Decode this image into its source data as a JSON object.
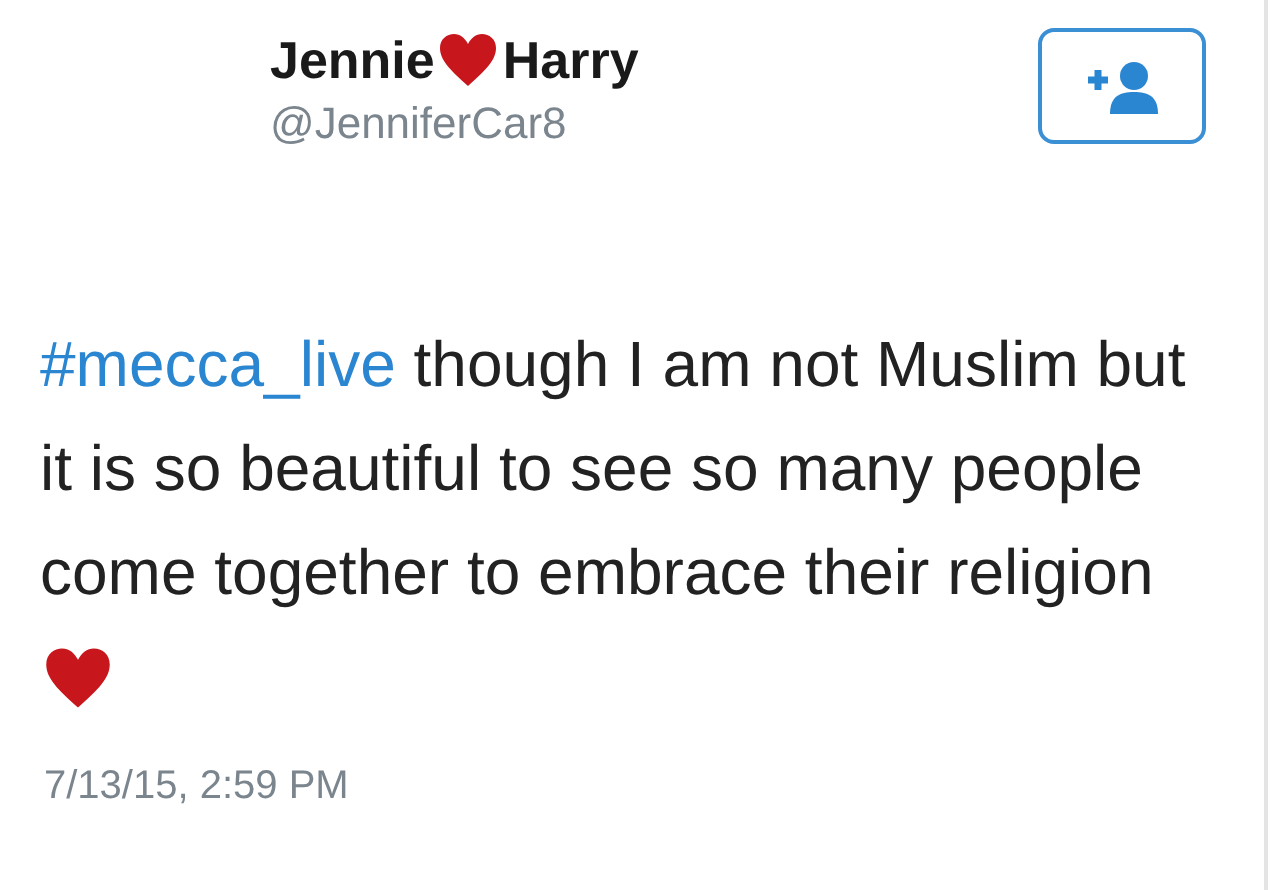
{
  "author": {
    "name_before": "Jennie",
    "name_after": "Harry",
    "handle": "@JenniferCar8"
  },
  "follow_button": {
    "kind": "add-user"
  },
  "tweet": {
    "hashtag": "#mecca_live",
    "text": "though I am not Muslim but it is so beautiful to see so many people come together to embrace their religion"
  },
  "timestamp": "7/13/15, 2:59 PM"
}
